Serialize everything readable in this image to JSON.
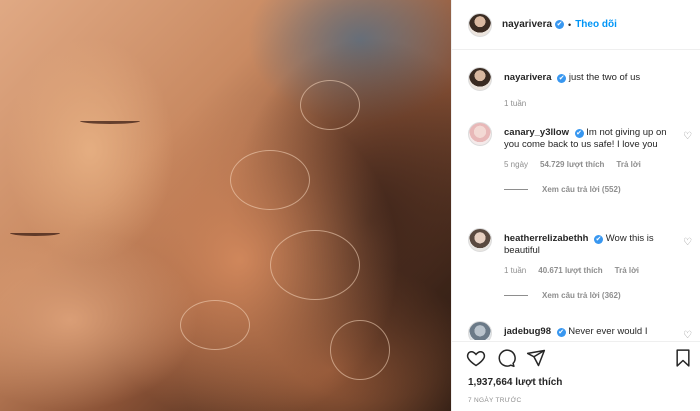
{
  "header": {
    "username": "nayarivera",
    "verified_mark": "✔",
    "separator": "•",
    "follow_label": "Theo dõi"
  },
  "caption": {
    "username": "nayarivera",
    "text": "just the two of us",
    "time": "1 tuần"
  },
  "comments": [
    {
      "username": "canary_y3llow",
      "text": "Im not giving up on you come back to us safe! I love you",
      "time": "5 ngày",
      "likes": "54.729 lượt thích",
      "reply": "Trả lời",
      "view_replies": "Xem câu trả lời (552)"
    },
    {
      "username": "heatherrelizabethh",
      "text": "Wow this is beautiful",
      "time": "1 tuần",
      "likes": "40.671 lượt thích",
      "reply": "Trả lời",
      "view_replies": "Xem câu trả lời (362)"
    },
    {
      "username": "jadebug98",
      "text": "Never ever would I",
      "time": "",
      "likes": "",
      "reply": "",
      "view_replies": ""
    }
  ],
  "actions": {
    "likes_count": "1,937,664 lượt thích",
    "date": "7 NGÀY TRƯỚC"
  },
  "icons": {
    "like": "heart-icon",
    "comment": "comment-icon",
    "share": "share-icon",
    "save": "bookmark-icon"
  },
  "colors": {
    "accent": "#0095f6",
    "verified": "#3897f0",
    "muted": "#8e8e8e",
    "text": "#262626"
  }
}
